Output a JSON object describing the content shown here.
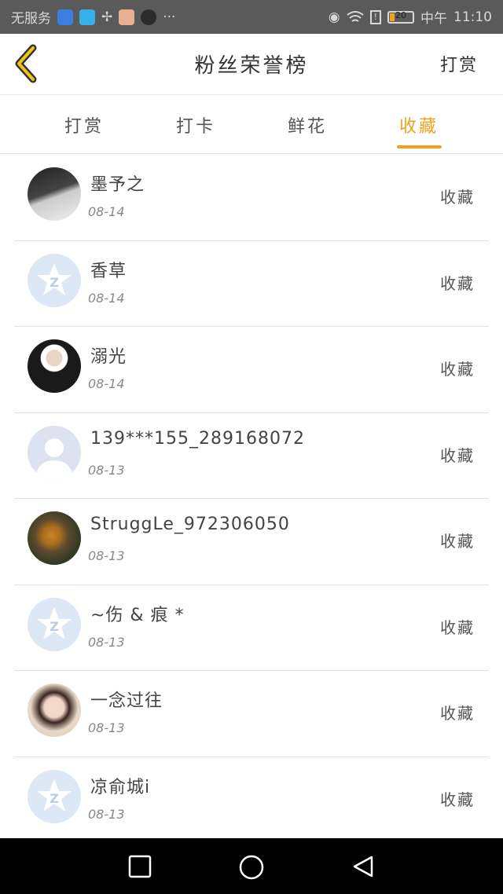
{
  "status_bar": {
    "carrier": "无服务",
    "network": "中午",
    "time": "11:10",
    "battery": "20",
    "app_icon_colors": [
      "#3c7de0",
      "#35b0e8",
      "#7a7a7a",
      "#e8b090",
      "#2b2b2b"
    ]
  },
  "header": {
    "back_icon": "chevron-left-icon",
    "title": "粉丝荣誉榜",
    "action": "打赏"
  },
  "tabs": [
    {
      "label": "打赏",
      "active": false
    },
    {
      "label": "打卡",
      "active": false
    },
    {
      "label": "鲜花",
      "active": false
    },
    {
      "label": "收藏",
      "active": true
    }
  ],
  "list": [
    {
      "name": "墨予之",
      "date": "08-14",
      "action": "收藏",
      "avatar": "photo"
    },
    {
      "name": "香草",
      "date": "08-14",
      "action": "收藏",
      "avatar": "default"
    },
    {
      "name": "溺光",
      "date": "08-14",
      "action": "收藏",
      "avatar": "photo"
    },
    {
      "name": "139***155_289168072",
      "date": "08-13",
      "action": "收藏",
      "avatar": "silhouette"
    },
    {
      "name": "StruggLe_972306050",
      "date": "08-13",
      "action": "收藏",
      "avatar": "photo"
    },
    {
      "name": "~伤 & 痕 *",
      "date": "08-13",
      "action": "收藏",
      "avatar": "default"
    },
    {
      "name": "一念过往",
      "date": "08-13",
      "action": "收藏",
      "avatar": "photo"
    },
    {
      "name": "凉俞城i",
      "date": "08-13",
      "action": "收藏",
      "avatar": "default"
    }
  ],
  "colors": {
    "accent": "#f0a21e",
    "status_bar_bg": "#5a5a5a",
    "nav_bar_bg": "#000000",
    "default_avatar": "#dde8f6"
  },
  "nav_bar": {
    "buttons": [
      "recents-square-icon",
      "home-circle-icon",
      "back-triangle-icon"
    ]
  }
}
